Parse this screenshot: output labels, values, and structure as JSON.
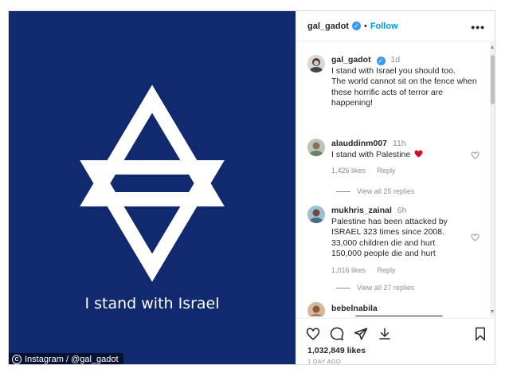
{
  "post": {
    "image_caption": "I stand with Israel",
    "watermark": "Instagram / @gal_gadot",
    "colors": {
      "background": "#11296f",
      "star": "#ffffff"
    }
  },
  "header": {
    "username": "gal_gadot",
    "separator": "•",
    "follow_label": "Follow",
    "more_label": "•••"
  },
  "caption": {
    "username": "gal_gadot",
    "time": "1d",
    "lines": [
      "I stand with Israel you should too.",
      "The world cannot sit on the fence when",
      "these horrific acts of terror are",
      "happening!"
    ]
  },
  "comments": [
    {
      "username": "alauddinm007",
      "time": "11h",
      "lines": [
        "I stand with Palestine"
      ],
      "likes": "1,426 likes",
      "reply_label": "Reply",
      "view_replies": "View all 25 replies"
    },
    {
      "username": "mukhris_zainal",
      "time": "6h",
      "lines": [
        "Palestine has been attacked by",
        "ISRAEL 323 times since 2008.",
        "33,000 children die and hurt",
        "150,000 people die and hurt"
      ],
      "likes": "1,016 likes",
      "reply_label": "Reply",
      "view_replies": "View all 27 replies"
    },
    {
      "username": "bebelnabila"
    }
  ],
  "footer": {
    "likes": "1,032,849 likes",
    "date": "1 DAY AGO"
  },
  "icons": [
    "heart-icon",
    "comment-icon",
    "share-icon",
    "save-icon",
    "verified-icon",
    "more-icon",
    "heart-emoji-icon"
  ]
}
